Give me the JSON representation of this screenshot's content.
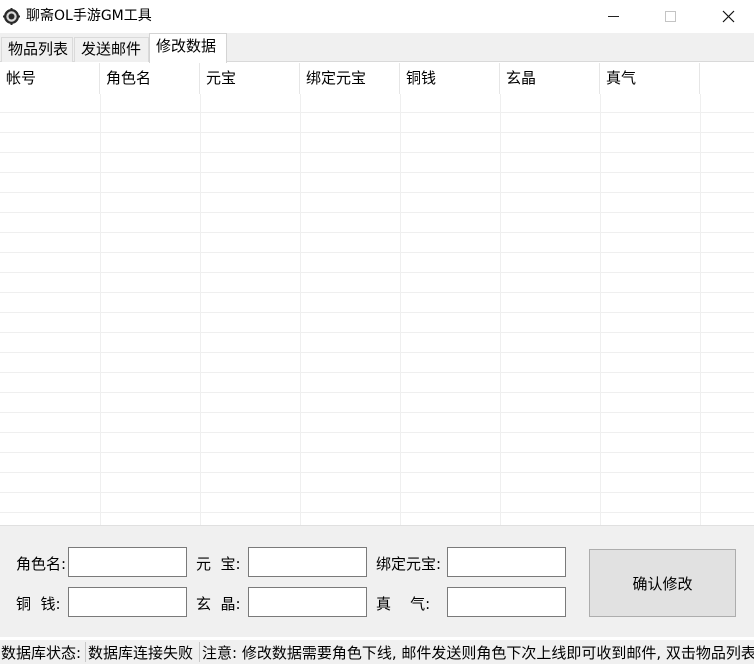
{
  "window": {
    "title": "聊斋OL手游GM工具",
    "icon": "gear-icon",
    "controls": [
      "minimize-icon",
      "maximize-icon",
      "close-icon"
    ]
  },
  "tabs": [
    {
      "label": "物品列表",
      "active": false
    },
    {
      "label": "发送邮件",
      "active": false
    },
    {
      "label": "修改数据",
      "active": true
    }
  ],
  "grid": {
    "columns": [
      "帐号",
      "角色名",
      "元宝",
      "绑定元宝",
      "铜钱",
      "玄晶",
      "真气"
    ],
    "rows": []
  },
  "form": {
    "role_name_label": "角色名:",
    "yuanbao_label": "元  宝:",
    "bound_yuanbao_label": "绑定元宝:",
    "copper_label": "铜  钱:",
    "xuanjing_label": "玄  晶:",
    "zhenqi_label": "真    气:",
    "role_name": "",
    "yuanbao": "",
    "bound_yuanbao": "",
    "copper": "",
    "xuanjing": "",
    "zhenqi": "",
    "confirm_label": "确认修改"
  },
  "status": {
    "db_label": "数据库状态:",
    "db_value": "数据库连接失败",
    "note": "注意: 修改数据需要角色下线, 邮件发送则角色下次上线即可收到邮件, 双击物品列表"
  }
}
